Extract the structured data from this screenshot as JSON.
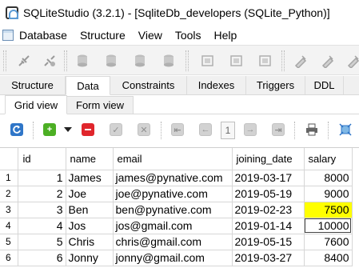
{
  "window": {
    "title": "SQLiteStudio (3.2.1) - [SqliteDb_developers (SQLite_Python)]"
  },
  "menu": [
    "Database",
    "Structure",
    "View",
    "Tools",
    "Help"
  ],
  "tabs": [
    "Structure",
    "Data",
    "Constraints",
    "Indexes",
    "Triggers",
    "DDL"
  ],
  "active_tab": "Data",
  "subtabs": [
    "Grid view",
    "Form view"
  ],
  "active_subtab": "Grid view",
  "pager": {
    "page": "1"
  },
  "colors": {
    "highlight": "#ffff00",
    "add": "#4caf24",
    "delete": "#e0262c",
    "refresh": "#2f76c8"
  },
  "grid": {
    "columns": [
      "id",
      "name",
      "email",
      "joining_date",
      "salary"
    ],
    "rows": [
      {
        "n": "1",
        "id": "1",
        "name": "James",
        "email": "james@pynative.com",
        "joining_date": "2019-03-17",
        "salary": "8000"
      },
      {
        "n": "2",
        "id": "2",
        "name": "Joe",
        "email": "joe@pynative.com",
        "joining_date": "2019-05-19",
        "salary": "9000"
      },
      {
        "n": "3",
        "id": "3",
        "name": "Ben",
        "email": "ben@pynative.com",
        "joining_date": "2019-02-23",
        "salary": "7500"
      },
      {
        "n": "4",
        "id": "4",
        "name": "Jos",
        "email": "jos@gmail.com",
        "joining_date": "2019-01-14",
        "salary": "10000"
      },
      {
        "n": "5",
        "id": "5",
        "name": "Chris",
        "email": "chris@gmail.com",
        "joining_date": "2019-05-15",
        "salary": "7600"
      },
      {
        "n": "6",
        "id": "6",
        "name": "Jonny",
        "email": "jonny@gmail.com",
        "joining_date": "2019-03-27",
        "salary": "8400"
      }
    ]
  }
}
